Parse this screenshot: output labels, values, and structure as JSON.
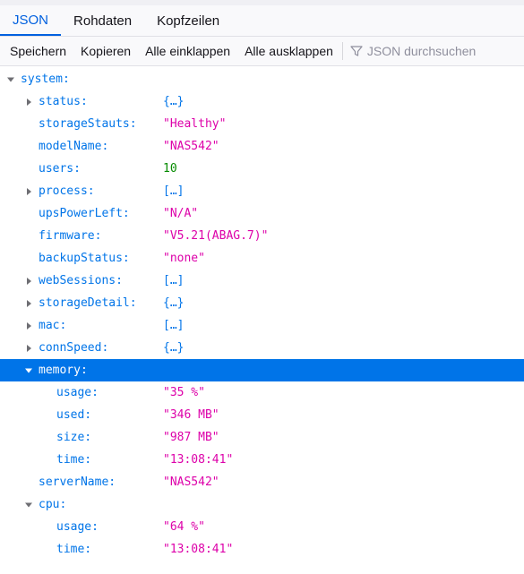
{
  "tabs": [
    {
      "label": "JSON",
      "active": true
    },
    {
      "label": "Rohdaten",
      "active": false
    },
    {
      "label": "Kopfzeilen",
      "active": false
    }
  ],
  "toolbar": {
    "save": "Speichern",
    "copy": "Kopieren",
    "collapse_all": "Alle einklappen",
    "expand_all": "Alle ausklappen",
    "filter_placeholder": "JSON durchsuchen"
  },
  "colors": {
    "accent": "#0060df",
    "key": "#0074e8",
    "string": "#dd00a9",
    "number": "#058b00",
    "selected_row": "#0074e8"
  },
  "tree": {
    "root_key": "system:",
    "rows": [
      {
        "key": "status:",
        "value": "{…}"
      },
      {
        "key": "storageStauts:",
        "value": "\"Healthy\""
      },
      {
        "key": "modelName:",
        "value": "\"NAS542\""
      },
      {
        "key": "users:",
        "value": "10"
      },
      {
        "key": "process:",
        "value": "[…]"
      },
      {
        "key": "upsPowerLeft:",
        "value": "\"N/A\""
      },
      {
        "key": "firmware:",
        "value": "\"V5.21(ABAG.7)\""
      },
      {
        "key": "backupStatus:",
        "value": "\"none\""
      },
      {
        "key": "webSessions:",
        "value": "[…]"
      },
      {
        "key": "storageDetail:",
        "value": "{…}"
      },
      {
        "key": "mac:",
        "value": "[…]"
      },
      {
        "key": "connSpeed:",
        "value": "{…}"
      },
      {
        "key": "memory:",
        "selected": true
      },
      {
        "key": "usage:",
        "value": "\"35 %\""
      },
      {
        "key": "used:",
        "value": "\"346 MB\""
      },
      {
        "key": "size:",
        "value": "\"987 MB\""
      },
      {
        "key": "time:",
        "value": "\"13:08:41\""
      },
      {
        "key": "serverName:",
        "value": "\"NAS542\""
      },
      {
        "key": "cpu:"
      },
      {
        "key": "usage:",
        "value": "\"64 %\""
      },
      {
        "key": "time:",
        "value": "\"13:08:41\""
      }
    ]
  }
}
